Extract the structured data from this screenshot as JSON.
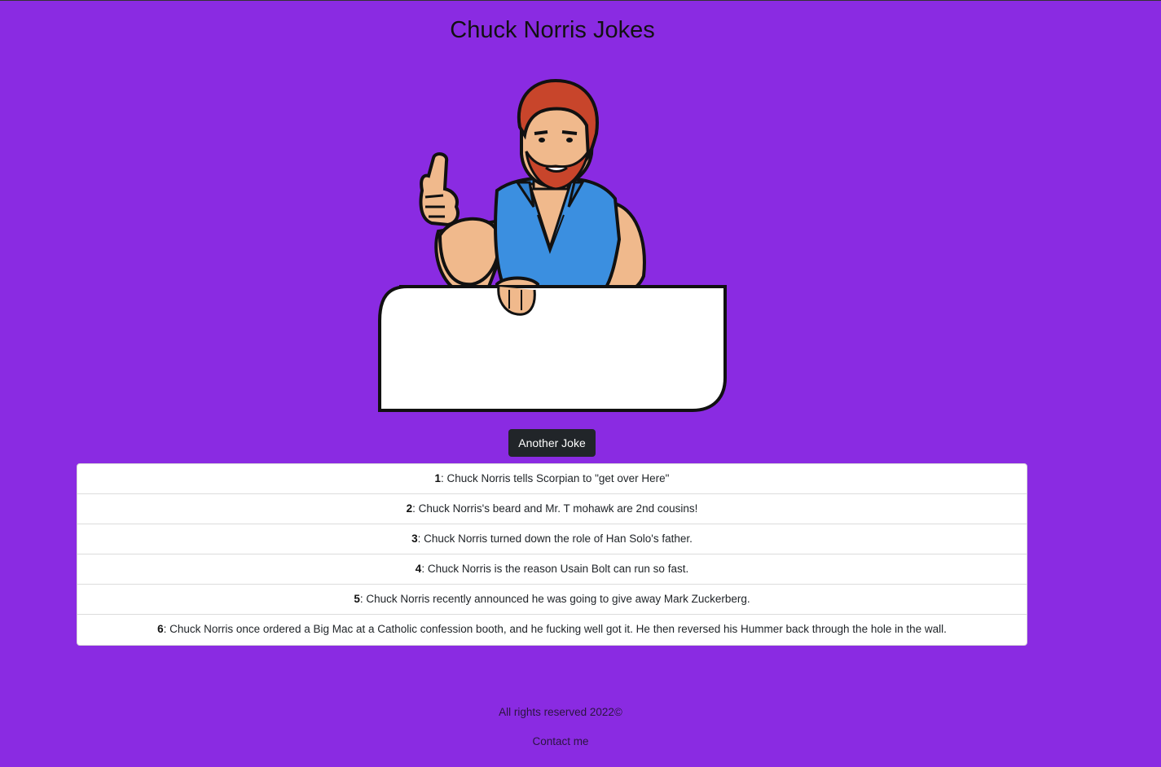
{
  "header": {
    "title": "Chuck Norris Jokes"
  },
  "colors": {
    "background": "#8a2be2",
    "button": "#212529",
    "card": "#ffffff"
  },
  "hero": {
    "icon": "chuck-norris-thumbs-up-illustration"
  },
  "controls": {
    "another_joke_label": "Another Joke"
  },
  "jokes": [
    {
      "num": "1",
      "text": ": Chuck Norris tells Scorpian to \"get over Here\""
    },
    {
      "num": "2",
      "text": ": Chuck Norris's beard and Mr. T mohawk are 2nd cousins!"
    },
    {
      "num": "3",
      "text": ": Chuck Norris turned down the role of Han Solo's father."
    },
    {
      "num": "4",
      "text": ": Chuck Norris is the reason Usain Bolt can run so fast."
    },
    {
      "num": "5",
      "text": ": Chuck Norris recently announced he was going to give away Mark Zuckerberg."
    },
    {
      "num": "6",
      "text": ": Chuck Norris once ordered a Big Mac at a Catholic confession booth, and he fucking well got it. He then reversed his Hummer back through the hole in the wall."
    }
  ],
  "footer": {
    "copyright": "All rights reserved 2022©",
    "contact": "Contact me"
  }
}
